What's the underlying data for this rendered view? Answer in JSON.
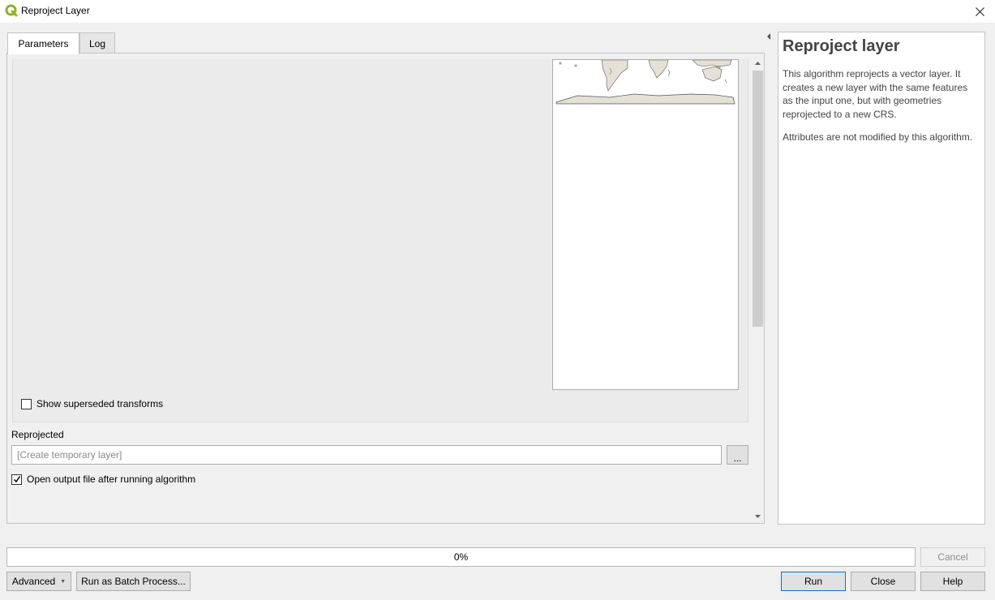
{
  "window": {
    "title": "Reproject Layer"
  },
  "tabs": [
    {
      "label": "Parameters",
      "active": true
    },
    {
      "label": "Log",
      "active": false
    }
  ],
  "params": {
    "superseded_label": "Show superseded transforms",
    "superseded_checked": false,
    "output_label": "Reprojected",
    "output_placeholder": "[Create temporary layer]",
    "browse_label": "...",
    "open_output_label": "Open output file after running algorithm",
    "open_output_checked": true
  },
  "help": {
    "title": "Reproject layer",
    "paragraphs": [
      "This algorithm reprojects a vector layer. It creates a new layer with the same features as the input one, but with geometries reprojected to a new CRS.",
      "Attributes are not modified by this algorithm."
    ]
  },
  "progress": {
    "value": 0,
    "text": "0%"
  },
  "buttons": {
    "cancel": "Cancel",
    "advanced": "Advanced",
    "batch": "Run as Batch Process...",
    "run": "Run",
    "close": "Close",
    "help": "Help"
  },
  "colors": {
    "qgis_green": "#93b023",
    "land_fill": "#e5e1d6",
    "land_stroke": "#555555"
  },
  "icons": {
    "app": "qgis-logo-icon",
    "close": "close-icon",
    "check": "checkmark-icon",
    "collapse": "collapse-arrow-icon"
  }
}
